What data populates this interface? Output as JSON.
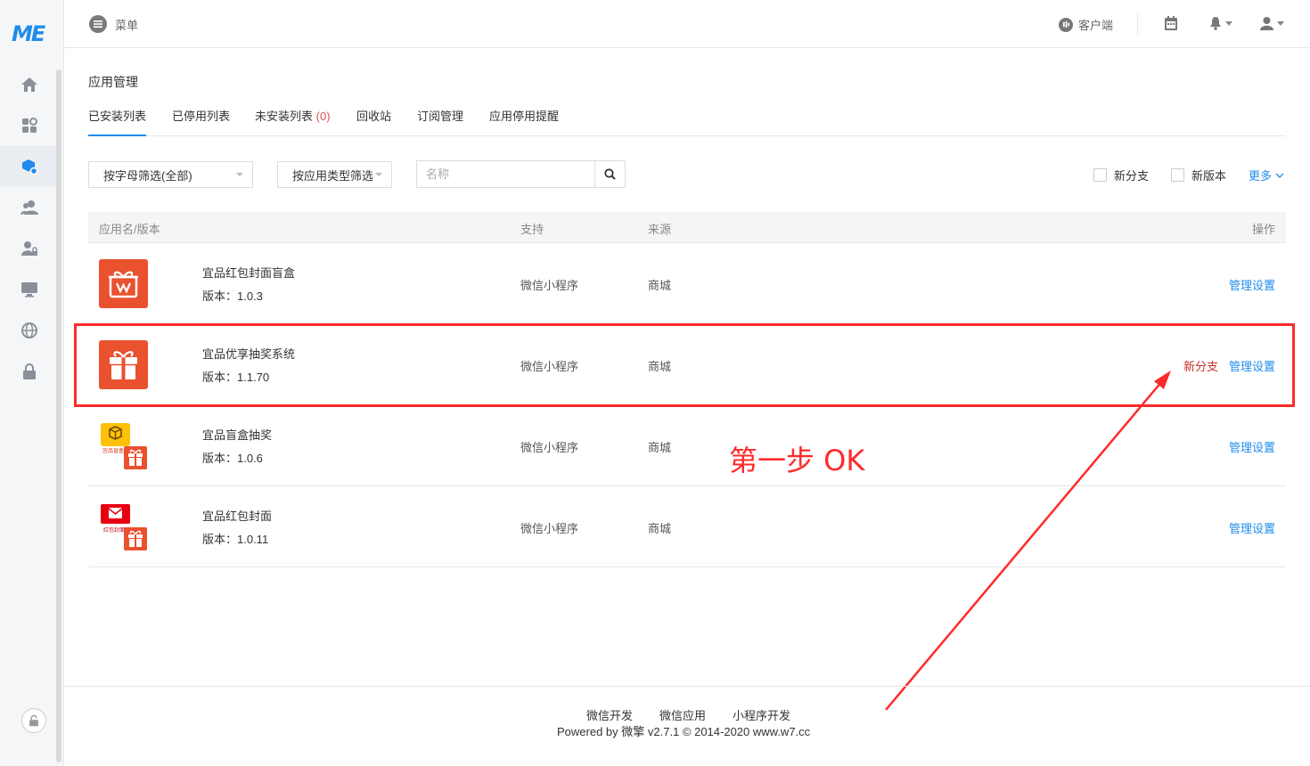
{
  "logo": "ME",
  "header": {
    "menu_label": "菜单",
    "client_label": "客户端"
  },
  "page": {
    "title": "应用管理"
  },
  "tabs": [
    {
      "label": "已安装列表"
    },
    {
      "label": "已停用列表"
    },
    {
      "label": "未安装列表",
      "count": "(0)"
    },
    {
      "label": "回收站"
    },
    {
      "label": "订阅管理"
    },
    {
      "label": "应用停用提醒"
    }
  ],
  "filters": {
    "letter": "按字母筛选(全部)",
    "type": "按应用类型筛选",
    "search_placeholder": "名称",
    "new_branch": "新分支",
    "new_version": "新版本",
    "more": "更多"
  },
  "table": {
    "columns": {
      "name": "应用名/版本",
      "support": "支持",
      "source": "来源",
      "action": "操作"
    },
    "rows": [
      {
        "name": "宜品红包封面盲盒",
        "version": "版本：1.0.3",
        "support": "微信小程序",
        "source": "商城",
        "manage": "管理设置"
      },
      {
        "name": "宜品优享抽奖系统",
        "version": "版本：1.1.70",
        "support": "微信小程序",
        "source": "商城",
        "branch": "新分支",
        "manage": "管理设置"
      },
      {
        "name": "宜品盲盒抽奖",
        "version": "版本：1.0.6",
        "support": "微信小程序",
        "source": "商城",
        "manage": "管理设置",
        "icon_text": "宜品盲盒"
      },
      {
        "name": "宜品红包封面",
        "version": "版本：1.0.11",
        "support": "微信小程序",
        "source": "商城",
        "manage": "管理设置",
        "icon_text": "红包封面"
      }
    ]
  },
  "annotation": {
    "text": "第一步 OK"
  },
  "footer": {
    "links": [
      "微信开发",
      "微信应用",
      "小程序开发"
    ],
    "copyright": "Powered by 微擎 v2.7.1 © 2014-2020 www.w7.cc"
  },
  "colors": {
    "accent": "#1f8ceb",
    "annotation": "#ff2a2a",
    "app_orange": "#e9512f",
    "branch_red": "#c9302c"
  }
}
